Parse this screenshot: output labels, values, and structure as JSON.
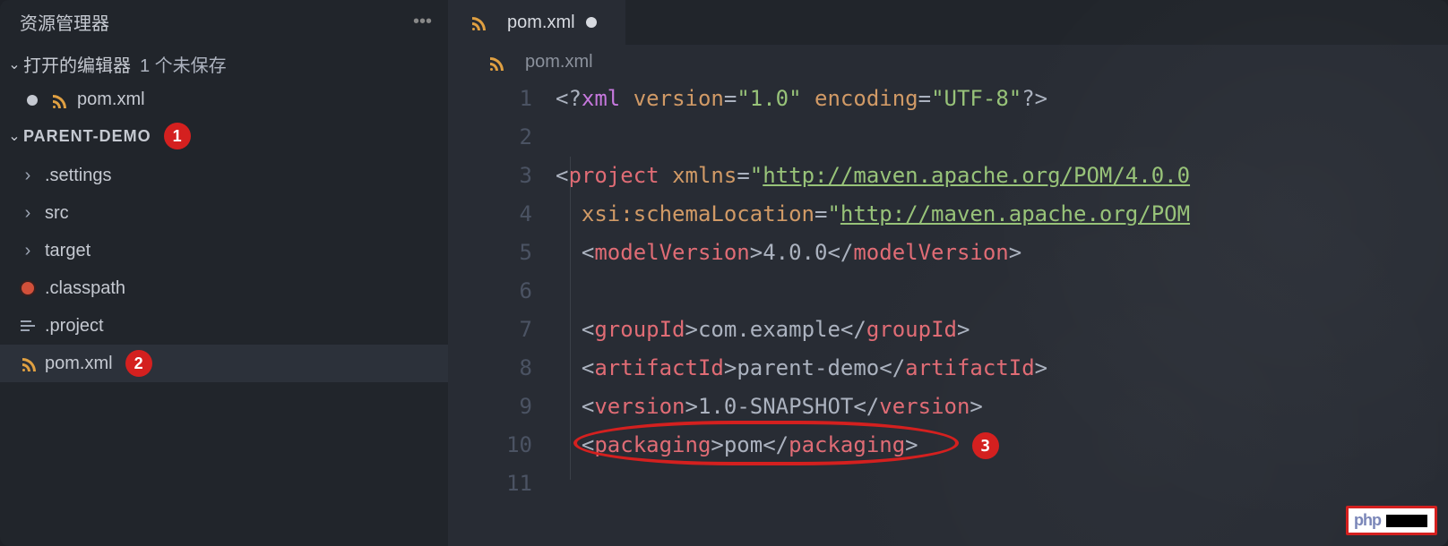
{
  "sidebar": {
    "title": "资源管理器",
    "openEditors": {
      "label": "打开的编辑器",
      "unsaved": "1 个未保存"
    },
    "openFile": {
      "name": "pom.xml",
      "icon": "rss-icon"
    },
    "project": {
      "name": "PARENT-DEMO"
    },
    "tree": [
      {
        "type": "folder",
        "label": ".settings"
      },
      {
        "type": "folder",
        "label": "src"
      },
      {
        "type": "folder",
        "label": "target"
      },
      {
        "type": "file",
        "label": ".classpath",
        "icon": "disk"
      },
      {
        "type": "file",
        "label": ".project",
        "icon": "lines"
      },
      {
        "type": "file",
        "label": "pom.xml",
        "icon": "rss",
        "selected": true
      }
    ]
  },
  "tab": {
    "name": "pom.xml",
    "dirty": true
  },
  "breadcrumb": {
    "name": "pom.xml"
  },
  "code": {
    "lines": [
      {
        "n": 1,
        "tokens": [
          {
            "t": "<?",
            "c": "p1"
          },
          {
            "t": "xml",
            "c": "kw"
          },
          {
            "t": " ",
            "c": "p1"
          },
          {
            "t": "version",
            "c": "attr"
          },
          {
            "t": "=",
            "c": "p1"
          },
          {
            "t": "\"1.0\"",
            "c": "str"
          },
          {
            "t": " ",
            "c": "p1"
          },
          {
            "t": "encoding",
            "c": "attr"
          },
          {
            "t": "=",
            "c": "p1"
          },
          {
            "t": "\"UTF-8\"",
            "c": "str"
          },
          {
            "t": "?>",
            "c": "p1"
          }
        ]
      },
      {
        "n": 2,
        "tokens": []
      },
      {
        "n": 3,
        "tokens": [
          {
            "t": "<",
            "c": "p1"
          },
          {
            "t": "project",
            "c": "tag"
          },
          {
            "t": " ",
            "c": "p1"
          },
          {
            "t": "xmlns",
            "c": "attr"
          },
          {
            "t": "=",
            "c": "p1"
          },
          {
            "t": "\"",
            "c": "str"
          },
          {
            "t": "http://maven.apache.org/POM/4.0.0",
            "c": "url"
          }
        ]
      },
      {
        "n": 4,
        "tokens": [
          {
            "t": "  ",
            "c": "p1"
          },
          {
            "t": "xsi:schemaLocation",
            "c": "attr"
          },
          {
            "t": "=",
            "c": "p1"
          },
          {
            "t": "\"",
            "c": "str"
          },
          {
            "t": "http://maven.apache.org/POM",
            "c": "url"
          }
        ]
      },
      {
        "n": 5,
        "tokens": [
          {
            "t": "  <",
            "c": "p1"
          },
          {
            "t": "modelVersion",
            "c": "tag"
          },
          {
            "t": ">",
            "c": "p1"
          },
          {
            "t": "4.0.0",
            "c": "txt"
          },
          {
            "t": "</",
            "c": "p1"
          },
          {
            "t": "modelVersion",
            "c": "tag"
          },
          {
            "t": ">",
            "c": "p1"
          }
        ]
      },
      {
        "n": 6,
        "tokens": []
      },
      {
        "n": 7,
        "tokens": [
          {
            "t": "  <",
            "c": "p1"
          },
          {
            "t": "groupId",
            "c": "tag"
          },
          {
            "t": ">",
            "c": "p1"
          },
          {
            "t": "com.example",
            "c": "txt"
          },
          {
            "t": "</",
            "c": "p1"
          },
          {
            "t": "groupId",
            "c": "tag"
          },
          {
            "t": ">",
            "c": "p1"
          }
        ]
      },
      {
        "n": 8,
        "tokens": [
          {
            "t": "  <",
            "c": "p1"
          },
          {
            "t": "artifactId",
            "c": "tag"
          },
          {
            "t": ">",
            "c": "p1"
          },
          {
            "t": "parent-demo",
            "c": "txt"
          },
          {
            "t": "</",
            "c": "p1"
          },
          {
            "t": "artifactId",
            "c": "tag"
          },
          {
            "t": ">",
            "c": "p1"
          }
        ]
      },
      {
        "n": 9,
        "tokens": [
          {
            "t": "  <",
            "c": "p1"
          },
          {
            "t": "version",
            "c": "tag"
          },
          {
            "t": ">",
            "c": "p1"
          },
          {
            "t": "1.0-SNAPSHOT",
            "c": "txt"
          },
          {
            "t": "</",
            "c": "p1"
          },
          {
            "t": "version",
            "c": "tag"
          },
          {
            "t": ">",
            "c": "p1"
          }
        ]
      },
      {
        "n": 10,
        "tokens": [
          {
            "t": "  <",
            "c": "p1"
          },
          {
            "t": "packaging",
            "c": "tag"
          },
          {
            "t": ">",
            "c": "p1"
          },
          {
            "t": "pom",
            "c": "txt"
          },
          {
            "t": "</",
            "c": "p1"
          },
          {
            "t": "packaging",
            "c": "tag"
          },
          {
            "t": ">",
            "c": "p1"
          }
        ]
      },
      {
        "n": 11,
        "tokens": []
      }
    ]
  },
  "annotations": {
    "badges": [
      {
        "n": "1",
        "target": "project-header"
      },
      {
        "n": "2",
        "target": "pom-file"
      },
      {
        "n": "3",
        "target": "packaging-line"
      }
    ],
    "ellipse": {
      "target": "packaging-line"
    }
  },
  "watermark": {
    "text": "php"
  }
}
